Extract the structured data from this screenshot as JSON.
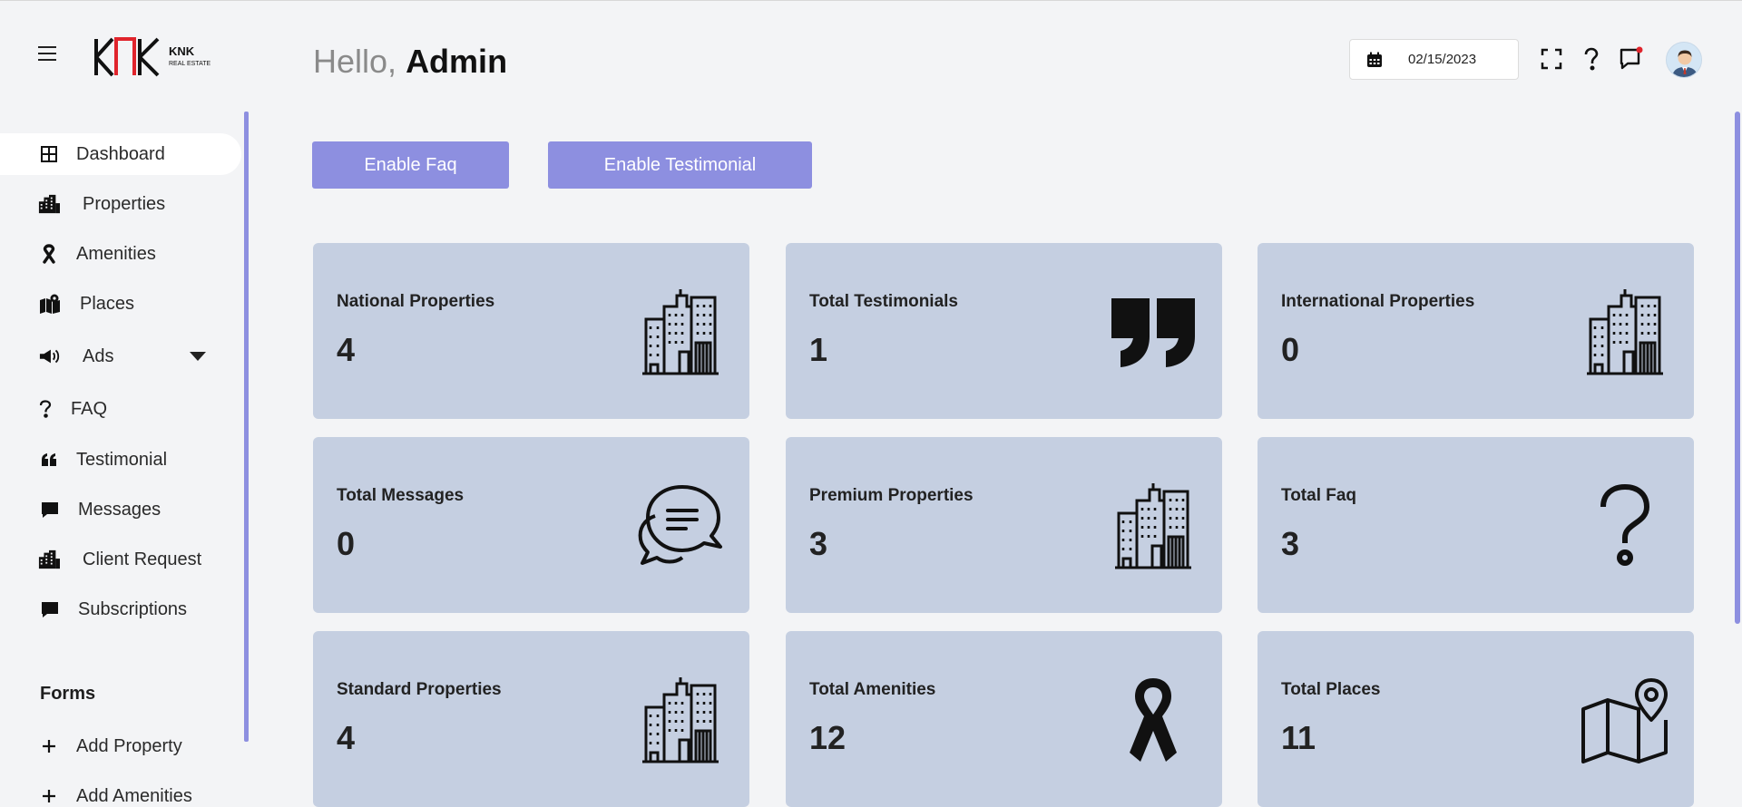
{
  "header": {
    "greeting_prefix": "Hello,",
    "greeting_name": "Admin",
    "date": "02/15/2023",
    "logo": {
      "mark": "KNK",
      "line1": "KNK",
      "line2": "REAL ESTATE"
    }
  },
  "sidebar": {
    "items": [
      {
        "label": "Dashboard",
        "icon": "dashboard-icon"
      },
      {
        "label": "Properties",
        "icon": "building-icon"
      },
      {
        "label": "Amenities",
        "icon": "ribbon-icon"
      },
      {
        "label": "Places",
        "icon": "map-icon"
      },
      {
        "label": "Ads",
        "icon": "megaphone-icon"
      },
      {
        "label": "FAQ",
        "icon": "question-icon"
      },
      {
        "label": "Testimonial",
        "icon": "quote-icon"
      },
      {
        "label": "Messages",
        "icon": "message-icon"
      },
      {
        "label": "Client Request",
        "icon": "building-icon"
      },
      {
        "label": "Subscriptions",
        "icon": "message-icon"
      }
    ],
    "forms_title": "Forms",
    "form_items": [
      {
        "label": "Add Property",
        "icon": "plus-icon"
      },
      {
        "label": "Add Amenities",
        "icon": "plus-icon"
      }
    ]
  },
  "actions": {
    "enable_faq": "Enable Faq",
    "enable_testimonial": "Enable Testimonial"
  },
  "cards": [
    {
      "title": "National Properties",
      "value": "4",
      "icon": "building-icon"
    },
    {
      "title": "Total Testimonials",
      "value": "1",
      "icon": "quote-icon"
    },
    {
      "title": "International Properties",
      "value": "0",
      "icon": "building-icon"
    },
    {
      "title": "Total Messages",
      "value": "0",
      "icon": "chat-bubbles-icon"
    },
    {
      "title": "Premium Properties",
      "value": "3",
      "icon": "building-icon"
    },
    {
      "title": "Total Faq",
      "value": "3",
      "icon": "question-icon"
    },
    {
      "title": "Standard Properties",
      "value": "4",
      "icon": "building-icon"
    },
    {
      "title": "Total Amenities",
      "value": "12",
      "icon": "ribbon-icon"
    },
    {
      "title": "Total Places",
      "value": "11",
      "icon": "map-pin-icon"
    }
  ],
  "colors": {
    "accent": "#8d8fe0",
    "card": "#c5cfe1",
    "background": "#f3f4f6"
  }
}
